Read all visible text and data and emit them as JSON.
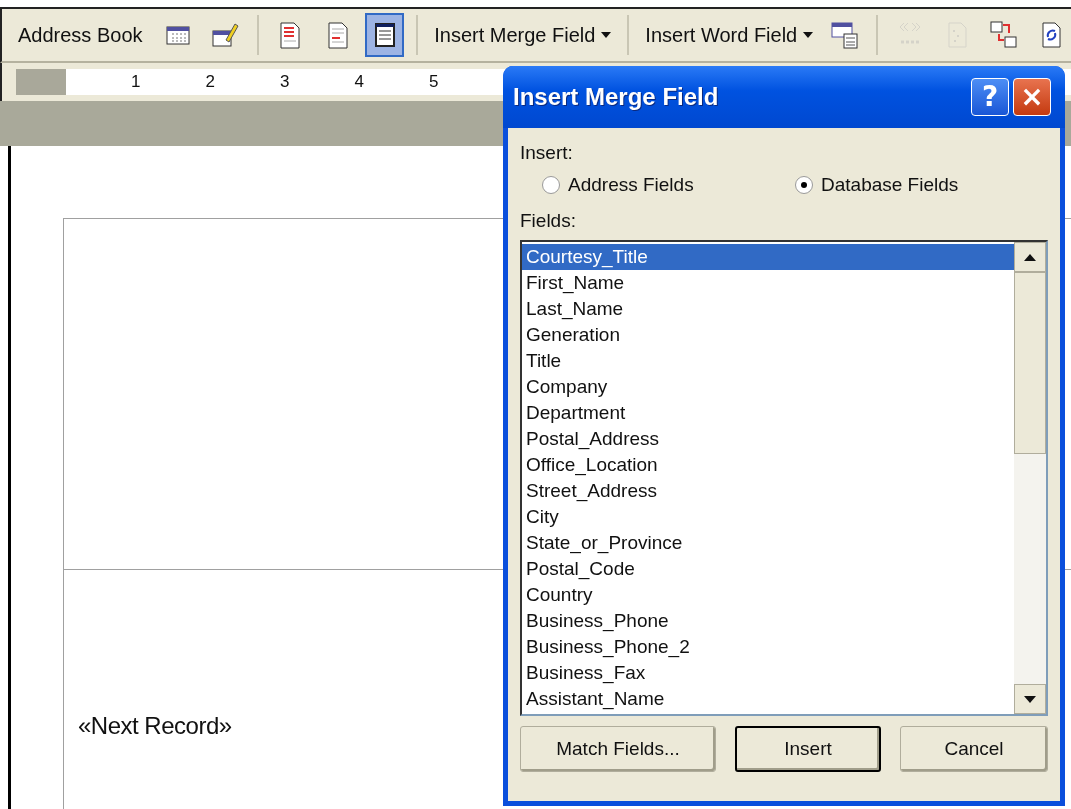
{
  "toolbar": [
    {
      "kind": "text",
      "label": "Address Book"
    },
    {
      "kind": "icon",
      "selected": false,
      "disabled": false
    },
    {
      "kind": "icon",
      "selected": false,
      "disabled": false
    },
    {
      "kind": "separator"
    },
    {
      "kind": "icon",
      "selected": false,
      "disabled": false
    },
    {
      "kind": "icon",
      "selected": false,
      "disabled": false
    },
    {
      "kind": "icon",
      "selected": true,
      "disabled": false
    },
    {
      "kind": "separator"
    },
    {
      "kind": "dropdown",
      "label": "Insert Merge Field"
    },
    {
      "kind": "separator"
    },
    {
      "kind": "dropdown",
      "label": "Insert Word Field"
    },
    {
      "kind": "icon",
      "selected": false,
      "disabled": false
    },
    {
      "kind": "separator"
    },
    {
      "kind": "icon",
      "selected": false,
      "disabled": true
    },
    {
      "kind": "icon",
      "selected": false,
      "disabled": true
    },
    {
      "kind": "icon",
      "selected": false,
      "disabled": false
    },
    {
      "kind": "icon",
      "selected": false,
      "disabled": false
    }
  ],
  "ruler": [
    "1",
    "2",
    "3",
    "4",
    "5"
  ],
  "document": {
    "text": "«Next Record»"
  },
  "dialog": {
    "title": "Insert Merge Field",
    "help": "?",
    "close": "×",
    "insert_label": "Insert:",
    "options": [
      {
        "label": "Address Fields",
        "selected": false
      },
      {
        "label": "Database Fields",
        "selected": true
      }
    ],
    "fields_label": "Fields:",
    "fields": [
      {
        "label": "Courtesy_Title",
        "selected": true
      },
      {
        "label": "First_Name",
        "selected": false
      },
      {
        "label": "Last_Name",
        "selected": false
      },
      {
        "label": "Generation",
        "selected": false
      },
      {
        "label": "Title",
        "selected": false
      },
      {
        "label": "Company",
        "selected": false
      },
      {
        "label": "Department",
        "selected": false
      },
      {
        "label": "Postal_Address",
        "selected": false
      },
      {
        "label": "Office_Location",
        "selected": false
      },
      {
        "label": "Street_Address",
        "selected": false
      },
      {
        "label": "City",
        "selected": false
      },
      {
        "label": "State_or_Province",
        "selected": false
      },
      {
        "label": "Postal_Code",
        "selected": false
      },
      {
        "label": "Country",
        "selected": false
      },
      {
        "label": "Business_Phone",
        "selected": false
      },
      {
        "label": "Business_Phone_2",
        "selected": false
      },
      {
        "label": "Business_Fax",
        "selected": false
      },
      {
        "label": "Assistant_Name",
        "selected": false
      }
    ],
    "buttons": [
      {
        "label": "Match Fields...",
        "default": false
      },
      {
        "label": "Insert",
        "default": true
      },
      {
        "label": "Cancel",
        "default": false
      }
    ]
  }
}
